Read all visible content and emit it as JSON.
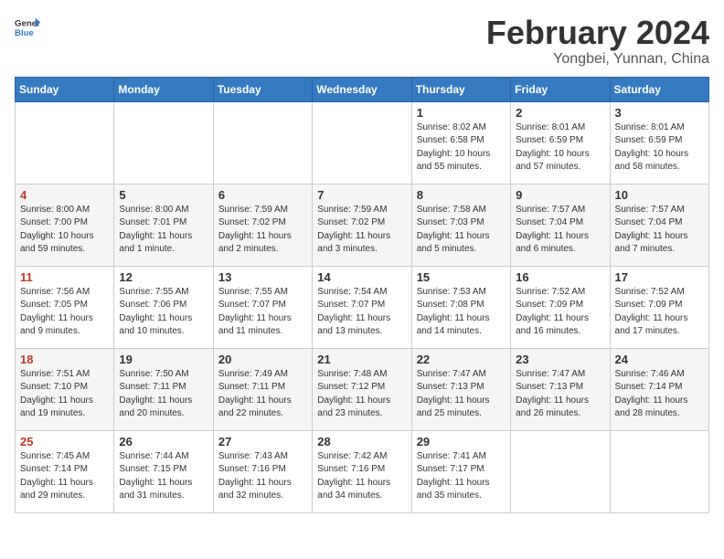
{
  "header": {
    "logo_general": "General",
    "logo_blue": "Blue",
    "title": "February 2024",
    "subtitle": "Yongbei, Yunnan, China"
  },
  "calendar": {
    "days_of_week": [
      "Sunday",
      "Monday",
      "Tuesday",
      "Wednesday",
      "Thursday",
      "Friday",
      "Saturday"
    ],
    "weeks": [
      [
        {
          "day": "",
          "info": ""
        },
        {
          "day": "",
          "info": ""
        },
        {
          "day": "",
          "info": ""
        },
        {
          "day": "",
          "info": ""
        },
        {
          "day": "1",
          "info": "Sunrise: 8:02 AM\nSunset: 6:58 PM\nDaylight: 10 hours\nand 55 minutes."
        },
        {
          "day": "2",
          "info": "Sunrise: 8:01 AM\nSunset: 6:59 PM\nDaylight: 10 hours\nand 57 minutes."
        },
        {
          "day": "3",
          "info": "Sunrise: 8:01 AM\nSunset: 6:59 PM\nDaylight: 10 hours\nand 58 minutes."
        }
      ],
      [
        {
          "day": "4",
          "info": "Sunrise: 8:00 AM\nSunset: 7:00 PM\nDaylight: 10 hours\nand 59 minutes."
        },
        {
          "day": "5",
          "info": "Sunrise: 8:00 AM\nSunset: 7:01 PM\nDaylight: 11 hours\nand 1 minute."
        },
        {
          "day": "6",
          "info": "Sunrise: 7:59 AM\nSunset: 7:02 PM\nDaylight: 11 hours\nand 2 minutes."
        },
        {
          "day": "7",
          "info": "Sunrise: 7:59 AM\nSunset: 7:02 PM\nDaylight: 11 hours\nand 3 minutes."
        },
        {
          "day": "8",
          "info": "Sunrise: 7:58 AM\nSunset: 7:03 PM\nDaylight: 11 hours\nand 5 minutes."
        },
        {
          "day": "9",
          "info": "Sunrise: 7:57 AM\nSunset: 7:04 PM\nDaylight: 11 hours\nand 6 minutes."
        },
        {
          "day": "10",
          "info": "Sunrise: 7:57 AM\nSunset: 7:04 PM\nDaylight: 11 hours\nand 7 minutes."
        }
      ],
      [
        {
          "day": "11",
          "info": "Sunrise: 7:56 AM\nSunset: 7:05 PM\nDaylight: 11 hours\nand 9 minutes."
        },
        {
          "day": "12",
          "info": "Sunrise: 7:55 AM\nSunset: 7:06 PM\nDaylight: 11 hours\nand 10 minutes."
        },
        {
          "day": "13",
          "info": "Sunrise: 7:55 AM\nSunset: 7:07 PM\nDaylight: 11 hours\nand 11 minutes."
        },
        {
          "day": "14",
          "info": "Sunrise: 7:54 AM\nSunset: 7:07 PM\nDaylight: 11 hours\nand 13 minutes."
        },
        {
          "day": "15",
          "info": "Sunrise: 7:53 AM\nSunset: 7:08 PM\nDaylight: 11 hours\nand 14 minutes."
        },
        {
          "day": "16",
          "info": "Sunrise: 7:52 AM\nSunset: 7:09 PM\nDaylight: 11 hours\nand 16 minutes."
        },
        {
          "day": "17",
          "info": "Sunrise: 7:52 AM\nSunset: 7:09 PM\nDaylight: 11 hours\nand 17 minutes."
        }
      ],
      [
        {
          "day": "18",
          "info": "Sunrise: 7:51 AM\nSunset: 7:10 PM\nDaylight: 11 hours\nand 19 minutes."
        },
        {
          "day": "19",
          "info": "Sunrise: 7:50 AM\nSunset: 7:11 PM\nDaylight: 11 hours\nand 20 minutes."
        },
        {
          "day": "20",
          "info": "Sunrise: 7:49 AM\nSunset: 7:11 PM\nDaylight: 11 hours\nand 22 minutes."
        },
        {
          "day": "21",
          "info": "Sunrise: 7:48 AM\nSunset: 7:12 PM\nDaylight: 11 hours\nand 23 minutes."
        },
        {
          "day": "22",
          "info": "Sunrise: 7:47 AM\nSunset: 7:13 PM\nDaylight: 11 hours\nand 25 minutes."
        },
        {
          "day": "23",
          "info": "Sunrise: 7:47 AM\nSunset: 7:13 PM\nDaylight: 11 hours\nand 26 minutes."
        },
        {
          "day": "24",
          "info": "Sunrise: 7:46 AM\nSunset: 7:14 PM\nDaylight: 11 hours\nand 28 minutes."
        }
      ],
      [
        {
          "day": "25",
          "info": "Sunrise: 7:45 AM\nSunset: 7:14 PM\nDaylight: 11 hours\nand 29 minutes."
        },
        {
          "day": "26",
          "info": "Sunrise: 7:44 AM\nSunset: 7:15 PM\nDaylight: 11 hours\nand 31 minutes."
        },
        {
          "day": "27",
          "info": "Sunrise: 7:43 AM\nSunset: 7:16 PM\nDaylight: 11 hours\nand 32 minutes."
        },
        {
          "day": "28",
          "info": "Sunrise: 7:42 AM\nSunset: 7:16 PM\nDaylight: 11 hours\nand 34 minutes."
        },
        {
          "day": "29",
          "info": "Sunrise: 7:41 AM\nSunset: 7:17 PM\nDaylight: 11 hours\nand 35 minutes."
        },
        {
          "day": "",
          "info": ""
        },
        {
          "day": "",
          "info": ""
        }
      ]
    ]
  }
}
